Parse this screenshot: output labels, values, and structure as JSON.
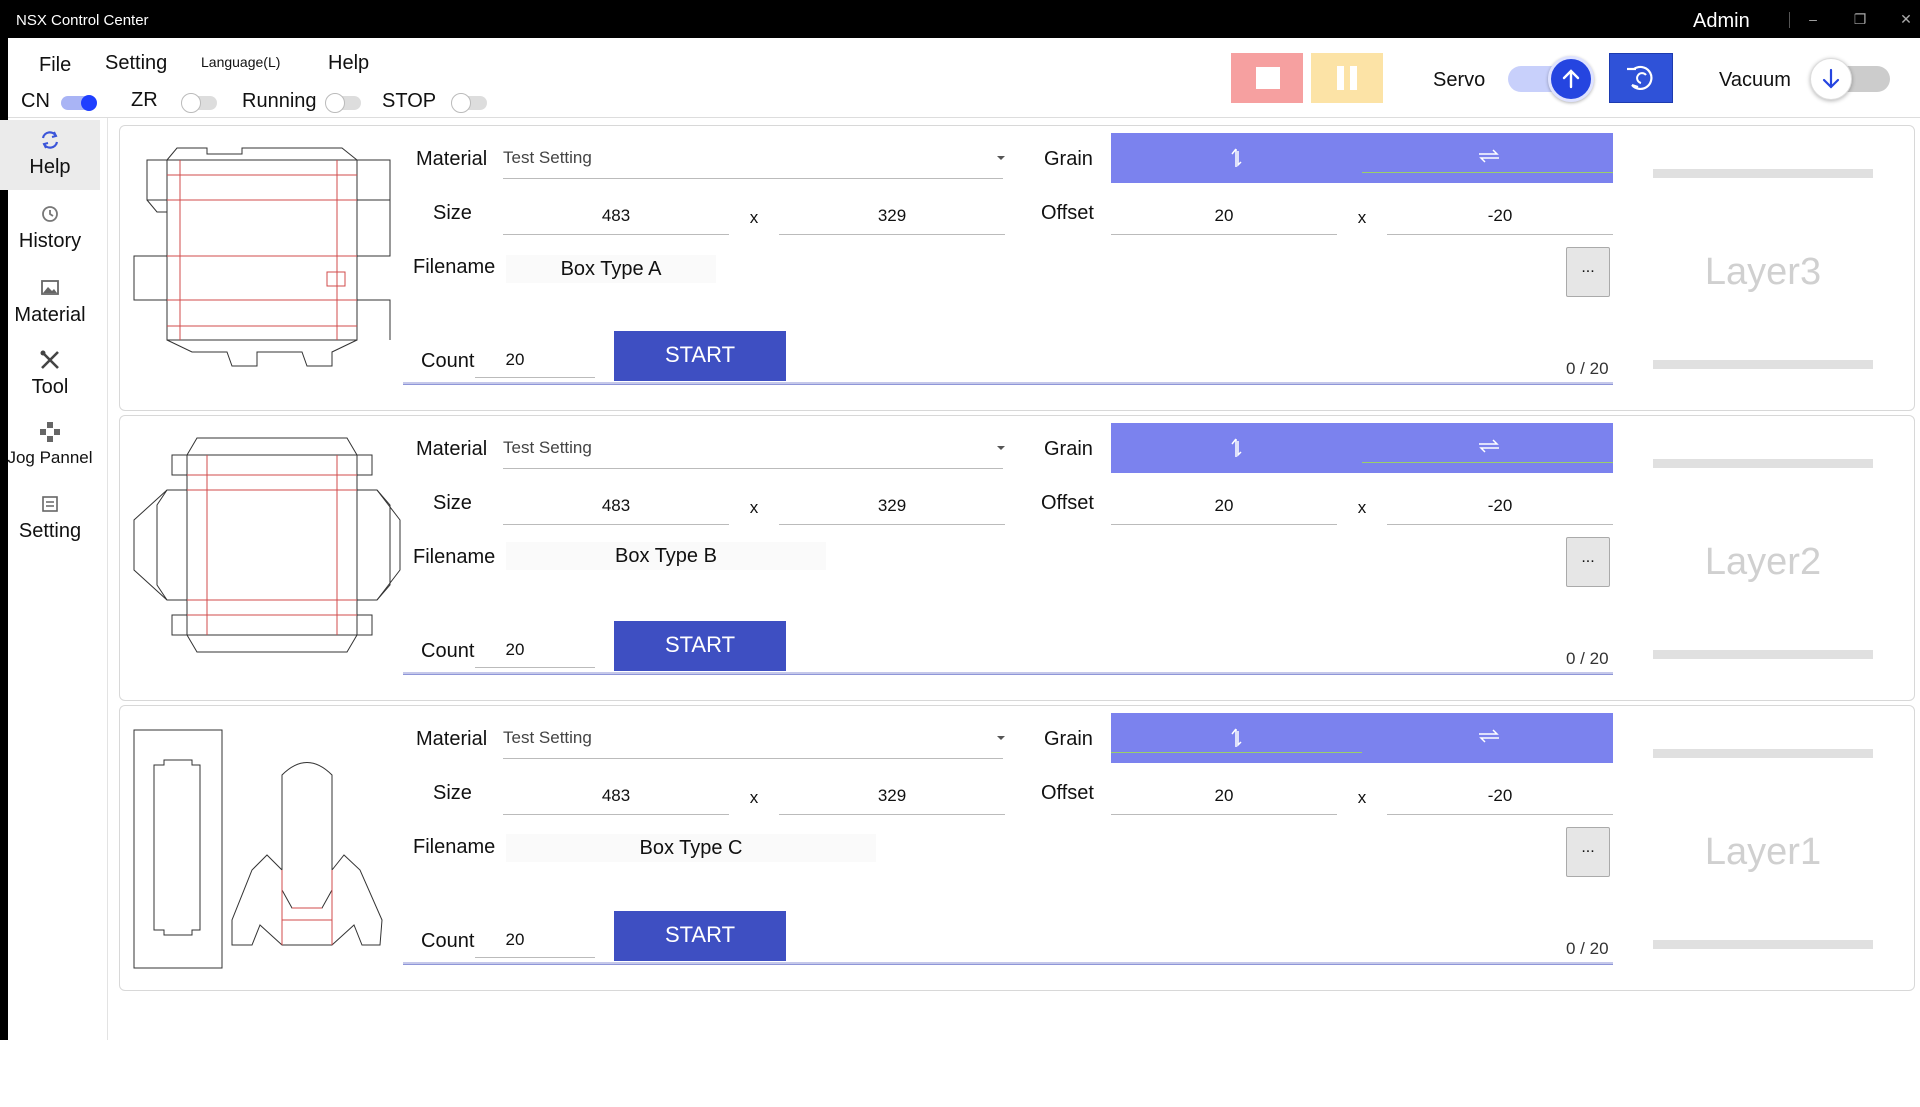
{
  "window": {
    "title": "NSX Control Center",
    "user": "Admin",
    "minimize_glyph": "–",
    "restore_glyph": "❐",
    "close_glyph": "✕"
  },
  "menu": {
    "file": "File",
    "setting": "Setting",
    "language": "Language(L)",
    "help": "Help"
  },
  "toggles": {
    "cn": "CN",
    "zr": "ZR",
    "running": "Running",
    "stop": "STOP"
  },
  "controls": {
    "servo": "Servo",
    "vacuum": "Vacuum",
    "stop_icon": "stop-icon",
    "pause_icon": "pause-icon",
    "servo_icon": "arrow-up-icon",
    "home_icon": "rotate-icon",
    "vacuum_icon": "arrow-down-icon"
  },
  "sidebar": {
    "items": [
      {
        "label": "Help",
        "icon": "refresh-icon"
      },
      {
        "label": "History",
        "icon": "history-icon"
      },
      {
        "label": "Material",
        "icon": "image-icon"
      },
      {
        "label": "Tool",
        "icon": "tools-icon"
      },
      {
        "label": "Jog Pannel",
        "icon": "jog-icon"
      },
      {
        "label": "Setting",
        "icon": "settings-icon"
      }
    ]
  },
  "labels": {
    "material": "Material",
    "size": "Size",
    "filename": "Filename",
    "count": "Count",
    "grain": "Grain",
    "offset": "Offset",
    "x": "x",
    "start": "START",
    "ellipsis": "..."
  },
  "panels": [
    {
      "material": "Test Setting",
      "size_w": "483",
      "size_h": "329",
      "filename": "Box Type A",
      "count": "20",
      "offset_x": "20",
      "offset_y": "-20",
      "progress": "0 / 20",
      "layer": "Layer3",
      "grain_selected": "right"
    },
    {
      "material": "Test Setting",
      "size_w": "483",
      "size_h": "329",
      "filename": "Box Type B",
      "count": "20",
      "offset_x": "20",
      "offset_y": "-20",
      "progress": "0 / 20",
      "layer": "Layer2",
      "grain_selected": "right"
    },
    {
      "material": "Test Setting",
      "size_w": "483",
      "size_h": "329",
      "filename": "Box Type C",
      "count": "20",
      "offset_x": "20",
      "offset_y": "-20",
      "progress": "0 / 20",
      "layer": "Layer1",
      "grain_selected": "left"
    }
  ],
  "colors": {
    "accent": "#3e4fc2",
    "grain": "#7b82ee",
    "stop": "#f6a0a0",
    "pause": "#fce3a6",
    "servo": "#2545e0",
    "cut_line": "#d24b4b"
  }
}
